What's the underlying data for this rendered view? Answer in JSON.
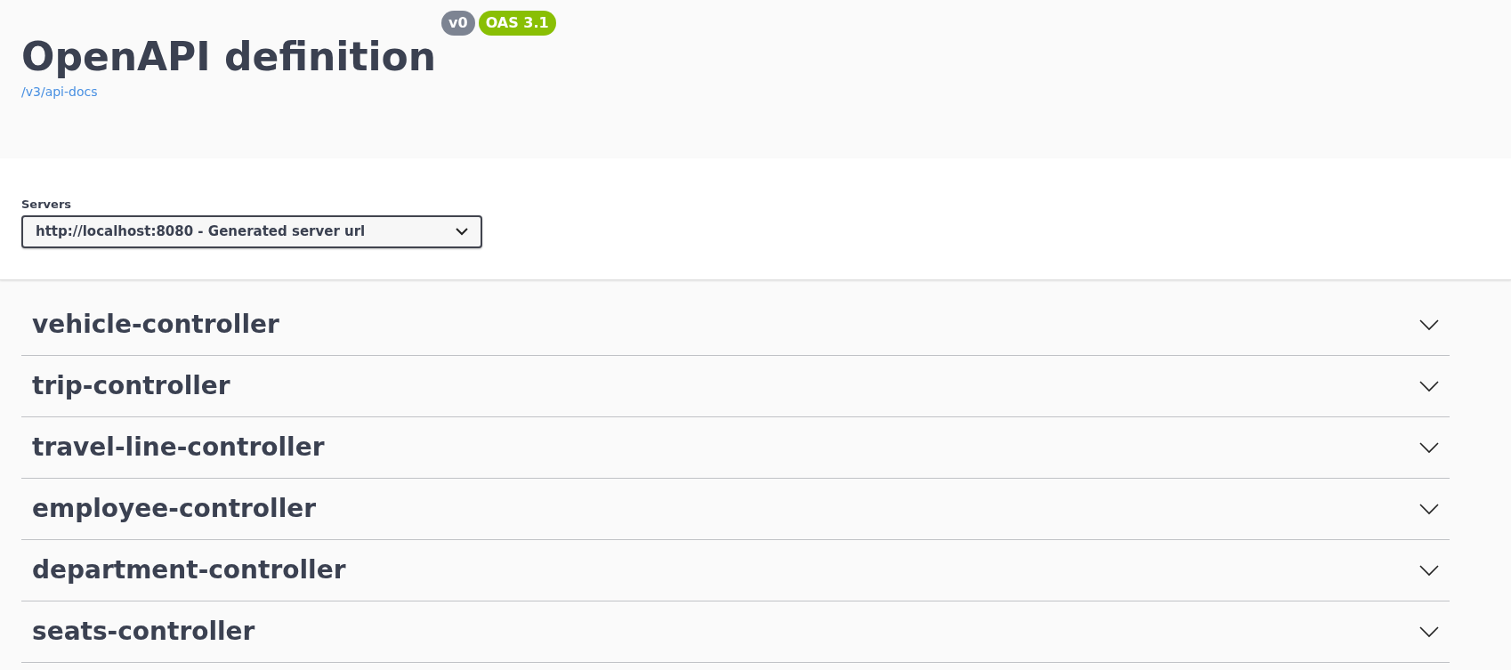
{
  "info": {
    "title": "OpenAPI definition",
    "version_badge": "v0",
    "spec_badge": "OAS 3.1",
    "link": "/v3/api-docs"
  },
  "servers": {
    "label": "Servers",
    "selected_value": "http://localhost:8080 - Generated server url"
  },
  "tags": [
    {
      "name": "vehicle-controller",
      "expanded": false
    },
    {
      "name": "trip-controller",
      "expanded": false
    },
    {
      "name": "travel-line-controller",
      "expanded": false
    },
    {
      "name": "employee-controller",
      "expanded": false
    },
    {
      "name": "department-controller",
      "expanded": false
    },
    {
      "name": "seats-controller",
      "expanded": false
    }
  ]
}
